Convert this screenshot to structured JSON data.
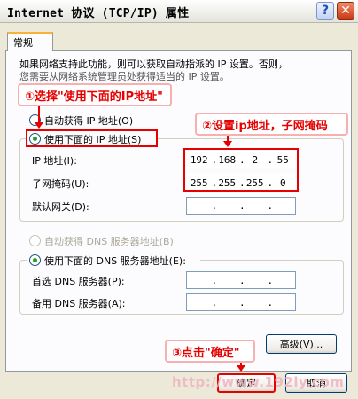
{
  "window": {
    "title": "Internet 协议 (TCP/IP) 属性",
    "help_glyph": "?",
    "close_glyph": "✕"
  },
  "tab": {
    "label": "常规"
  },
  "description": {
    "line1": "如果网络支持此功能，则可以获取自动指派的 IP 设置。否则，",
    "line2": "您需要从网络系统管理员处获得适当的 IP 设置。"
  },
  "ip_section": {
    "auto_label": "自动获得 IP 地址(O)",
    "manual_label": "使用下面的 IP 地址(S)",
    "selected": "manual",
    "fields": [
      {
        "label": "IP 地址(I):",
        "octets": [
          "192",
          "168",
          "2",
          "55"
        ]
      },
      {
        "label": "子网掩码(U):",
        "octets": [
          "255",
          "255",
          "255",
          "0"
        ]
      },
      {
        "label": "默认网关(D):",
        "octets": [
          "",
          "",
          "",
          ""
        ]
      }
    ]
  },
  "dns_section": {
    "auto_label": "自动获得 DNS 服务器地址(B)",
    "manual_label": "使用下面的 DNS 服务器地址(E):",
    "selected": "manual",
    "fields": [
      {
        "label": "首选 DNS 服务器(P):",
        "octets": [
          "",
          "",
          "",
          ""
        ]
      },
      {
        "label": "备用 DNS 服务器(A):",
        "octets": [
          "",
          "",
          "",
          ""
        ]
      }
    ]
  },
  "buttons": {
    "advanced": "高级(V)...",
    "ok": "确定",
    "cancel": "取消"
  },
  "annotations": {
    "step1": "①选择\"使用下面的IP地址\"",
    "step2": "②设置ip地址，子网掩码",
    "step3": "③点击\"确定\""
  },
  "watermark": "http://www.192ly.com",
  "colors": {
    "annotation_red": "#e60000",
    "radio_checked": "#21a121",
    "dialog_bg": "#ece9d8"
  }
}
